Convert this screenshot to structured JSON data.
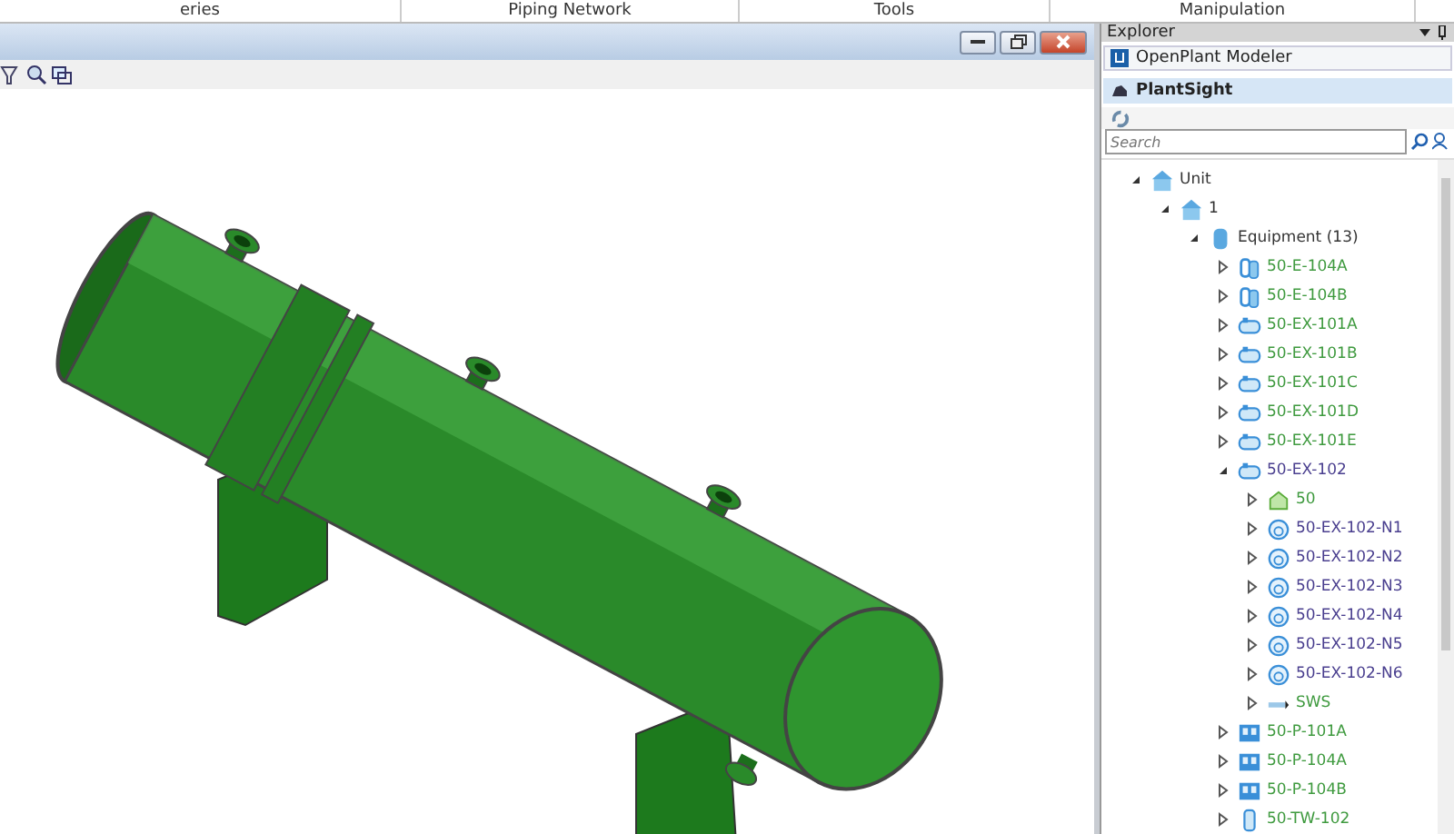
{
  "ribbon": {
    "groups": [
      "eries",
      "Piping Network",
      "Tools",
      "Manipulation"
    ]
  },
  "explorer": {
    "title": "Explorer",
    "sections": [
      {
        "label": "OpenPlant Modeler",
        "selected": false
      },
      {
        "label": "PlantSight",
        "selected": true
      }
    ],
    "search": {
      "placeholder": "Search"
    },
    "tree": [
      {
        "label": "Unit",
        "kind": "unit",
        "color": "#333333",
        "expanded": true,
        "children": [
          {
            "label": "1",
            "kind": "unit",
            "color": "#333333",
            "expanded": true,
            "children": [
              {
                "label": "Equipment (13)",
                "kind": "equipment",
                "color": "#333333",
                "expanded": true,
                "children": [
                  {
                    "label": "50-E-104A",
                    "kind": "exchanger",
                    "color": "#3f9a3f",
                    "expanded": false
                  },
                  {
                    "label": "50-E-104B",
                    "kind": "exchanger",
                    "color": "#3f9a3f",
                    "expanded": false
                  },
                  {
                    "label": "50-EX-101A",
                    "kind": "vessel",
                    "color": "#3f9a3f",
                    "expanded": false
                  },
                  {
                    "label": "50-EX-101B",
                    "kind": "vessel",
                    "color": "#3f9a3f",
                    "expanded": false
                  },
                  {
                    "label": "50-EX-101C",
                    "kind": "vessel",
                    "color": "#3f9a3f",
                    "expanded": false
                  },
                  {
                    "label": "50-EX-101D",
                    "kind": "vessel",
                    "color": "#3f9a3f",
                    "expanded": false
                  },
                  {
                    "label": "50-EX-101E",
                    "kind": "vessel",
                    "color": "#3f9a3f",
                    "expanded": false
                  },
                  {
                    "label": "50-EX-102",
                    "kind": "vessel",
                    "color": "#4a3f8f",
                    "expanded": true,
                    "children": [
                      {
                        "label": "50",
                        "kind": "component",
                        "color": "#3f9a3f",
                        "expanded": false
                      },
                      {
                        "label": "50-EX-102-N1",
                        "kind": "nozzle",
                        "color": "#4a3f8f",
                        "expanded": false
                      },
                      {
                        "label": "50-EX-102-N2",
                        "kind": "nozzle",
                        "color": "#4a3f8f",
                        "expanded": false
                      },
                      {
                        "label": "50-EX-102-N3",
                        "kind": "nozzle",
                        "color": "#4a3f8f",
                        "expanded": false
                      },
                      {
                        "label": "50-EX-102-N4",
                        "kind": "nozzle",
                        "color": "#4a3f8f",
                        "expanded": false
                      },
                      {
                        "label": "50-EX-102-N5",
                        "kind": "nozzle",
                        "color": "#4a3f8f",
                        "expanded": false
                      },
                      {
                        "label": "50-EX-102-N6",
                        "kind": "nozzle",
                        "color": "#4a3f8f",
                        "expanded": false
                      },
                      {
                        "label": "SWS",
                        "kind": "line",
                        "color": "#3f9a3f",
                        "expanded": false
                      }
                    ]
                  },
                  {
                    "label": "50-P-101A",
                    "kind": "pump",
                    "color": "#3f9a3f",
                    "expanded": false
                  },
                  {
                    "label": "50-P-104A",
                    "kind": "pump",
                    "color": "#3f9a3f",
                    "expanded": false
                  },
                  {
                    "label": "50-P-104B",
                    "kind": "pump",
                    "color": "#3f9a3f",
                    "expanded": false
                  },
                  {
                    "label": "50-TW-102",
                    "kind": "tower",
                    "color": "#3f9a3f",
                    "expanded": false
                  }
                ]
              }
            ]
          }
        ]
      }
    ]
  }
}
